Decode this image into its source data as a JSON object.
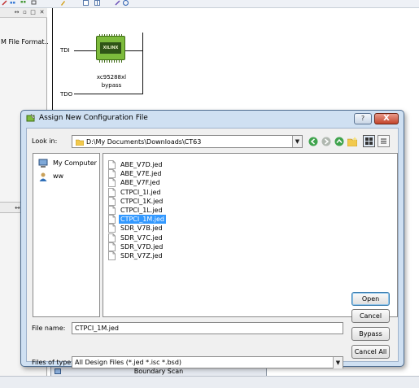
{
  "left_panel": {
    "file_format_text": "M File Format..."
  },
  "canvas": {
    "tdi_label": "TDI",
    "tdo_label": "TDO",
    "chip_logo": "XILINX",
    "chip_name": "xc95288xl",
    "chip_mode": "bypass"
  },
  "bottom_tab": {
    "label": "Boundary Scan"
  },
  "dialog": {
    "title": "Assign New Configuration File",
    "help_label": "?",
    "close_label": "X",
    "look_in_label": "Look in:",
    "look_in_value": "D:\\My Documents\\Downloads\\CT63",
    "sidebar": [
      {
        "label": "My Computer",
        "icon": "computer-icon"
      },
      {
        "label": "ww",
        "icon": "user-icon"
      }
    ],
    "files": [
      {
        "name": "ABE_V7D.jed",
        "selected": false
      },
      {
        "name": "ABE_V7E.jed",
        "selected": false
      },
      {
        "name": "ABE_V7F.jed",
        "selected": false
      },
      {
        "name": "CTPCI_1I.jed",
        "selected": false
      },
      {
        "name": "CTPCI_1K.jed",
        "selected": false
      },
      {
        "name": "CTPCI_1L.jed",
        "selected": false
      },
      {
        "name": "CTPCI_1M.jed",
        "selected": true
      },
      {
        "name": "SDR_V7B.jed",
        "selected": false
      },
      {
        "name": "SDR_V7C.jed",
        "selected": false
      },
      {
        "name": "SDR_V7D.jed",
        "selected": false
      },
      {
        "name": "SDR_V7Z.jed",
        "selected": false
      }
    ],
    "file_name_label": "File name:",
    "file_name_value": "CTPCI_1M.jed",
    "files_of_type_label": "Files of type:",
    "files_of_type_value": "All Design Files (*.jed *.isc *.bsd)",
    "buttons": {
      "open": "Open",
      "cancel": "Cancel",
      "bypass": "Bypass",
      "cancel_all": "Cancel All"
    }
  },
  "colors": {
    "selection": "#3399ff",
    "dialog_frame": "#cfe0f2",
    "chip_green": "#7dbb3c"
  }
}
